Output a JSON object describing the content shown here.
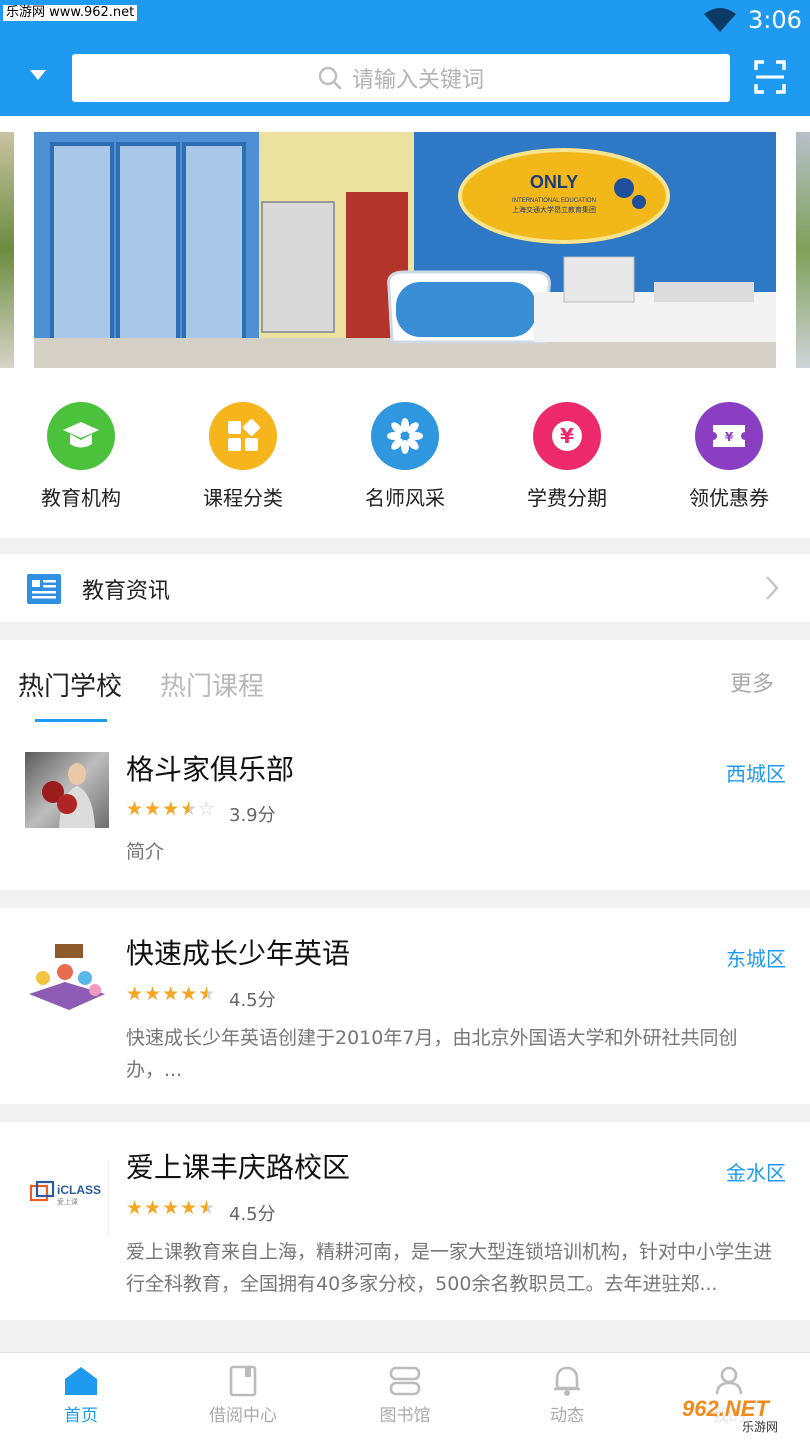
{
  "status_bar": {
    "watermark": "乐游网 www.962.net",
    "time": "3:06"
  },
  "header": {
    "search_placeholder": "请输入关键词"
  },
  "quick_icons": [
    {
      "label": "教育机构",
      "icon": "graduation-cap-icon",
      "color": "#4cc13b"
    },
    {
      "label": "课程分类",
      "icon": "category-grid-icon",
      "color": "#f7b51d"
    },
    {
      "label": "名师风采",
      "icon": "flower-icon",
      "color": "#2f96e0"
    },
    {
      "label": "学费分期",
      "icon": "yen-icon",
      "color": "#ee2a6c"
    },
    {
      "label": "领优惠券",
      "icon": "coupon-icon",
      "color": "#8a3fc3"
    }
  ],
  "news": {
    "label": "教育资讯"
  },
  "tabs": {
    "active": "热门学校",
    "inactive": "热门课程",
    "more": "更多"
  },
  "schools": [
    {
      "name": "格斗家俱乐部",
      "rating": 3.5,
      "score": "3.9分",
      "district": "西城区",
      "intro": "简介"
    },
    {
      "name": "快速成长少年英语",
      "rating": 4.5,
      "score": "4.5分",
      "district": "东城区",
      "intro": "快速成长少年英语创建于2010年7月，由北京外国语大学和外研社共同创办，..."
    },
    {
      "name": "爱上课丰庆路校区",
      "rating": 4.5,
      "score": "4.5分",
      "district": "金水区",
      "intro": "爱上课教育来自上海，精耕河南，是一家大型连锁培训机构，针对中小学生进行全科教育，全国拥有40多家分校，500余名教职员工。去年进驻郑..."
    }
  ],
  "banner_sign": {
    "brand": "ONLY",
    "line1": "INTERNATIONAL EDUCATION",
    "line2": "上海交通大学昂立教育集团"
  },
  "iclass_logo": "iCLASS",
  "iclass_sub": "爱上课",
  "bottom_nav": [
    {
      "label": "首页",
      "icon": "home-icon",
      "active": true
    },
    {
      "label": "借阅中心",
      "icon": "book-icon",
      "active": false
    },
    {
      "label": "图书馆",
      "icon": "library-icon",
      "active": false
    },
    {
      "label": "动态",
      "icon": "bell-icon",
      "active": false
    },
    {
      "label": "我的",
      "icon": "user-icon",
      "active": false
    }
  ],
  "corner_logo": {
    "text": "962.NET",
    "sub": "乐游网"
  }
}
